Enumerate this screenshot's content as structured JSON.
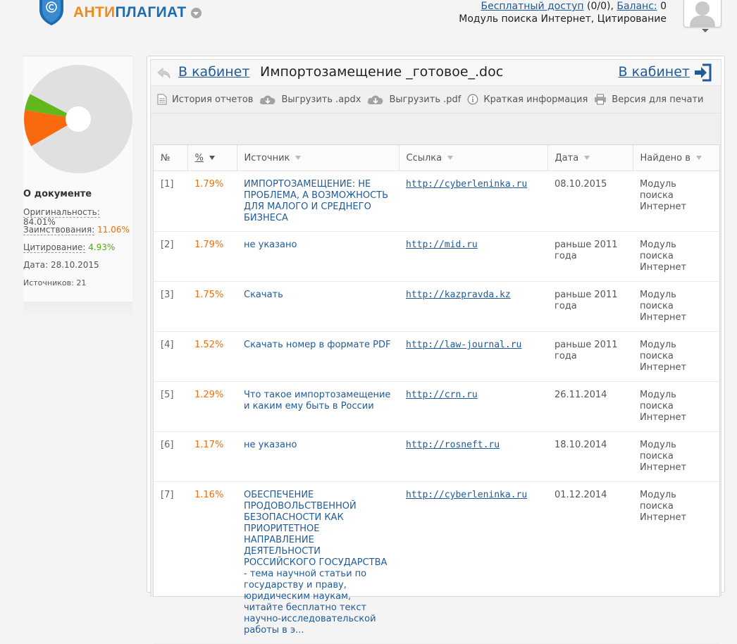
{
  "header": {
    "logo_part1": "АНТИ",
    "logo_part2": "ПЛАГИАТ",
    "free_access_label": "Бесплатный доступ",
    "free_access_value": "(0/0),",
    "balance_label": "Баланс:",
    "balance_value": "0",
    "modules": "Модуль поиска Интернет, Цитирование"
  },
  "sidebar": {
    "title": "О документе",
    "originality_label": "Оригинальность:",
    "originality_value": "84.01%",
    "borrowing_label": "Заимствования:",
    "borrowing_value": "11.06%",
    "citation_label": "Цитирование:",
    "citation_value": "4.93%",
    "date_label": "Дата:",
    "date_value": "28.10.2015",
    "sources_label": "Источников:",
    "sources_value": "21"
  },
  "chart_data": {
    "type": "pie",
    "slices": [
      {
        "label": "Оригинальность",
        "value": 84.01,
        "color": "#e0e0e0"
      },
      {
        "label": "Заимствования",
        "value": 11.06,
        "color": "#f96a0e"
      },
      {
        "label": "Цитирование",
        "value": 4.93,
        "color": "#62b71d"
      }
    ]
  },
  "panel": {
    "cabinet_link": "В кабинет",
    "doc_title": "Импортозамещение _готовое_.doc",
    "cabinet_link_right": "В кабинет"
  },
  "toolbar": {
    "history": "История отчетов",
    "export_apdx": "Выгрузить .apdx",
    "export_pdf": "Выгрузить .pdf",
    "brief": "Краткая информация",
    "print": "Версия для печати"
  },
  "table": {
    "headers": {
      "num": "№",
      "pct": "%",
      "source": "Источник",
      "link": "Ссылка",
      "date": "Дата",
      "found": "Найдено в"
    },
    "rows": [
      {
        "num": "[1]",
        "pct": "1.79%",
        "source": "ИМПОРТОЗАМЕЩЕНИЕ: НЕ ПРОБЛЕМА, А ВОЗМОЖНОСТЬ ДЛЯ МАЛОГО И СРЕДНЕГО БИЗНЕСА",
        "link": "http://cyberleninka.ru",
        "date": "08.10.2015",
        "found": "Модуль поиска Интернет"
      },
      {
        "num": "[2]",
        "pct": "1.79%",
        "source": "не указано",
        "link": "http://mid.ru",
        "date": "раньше 2011 года",
        "found": "Модуль поиска Интернет"
      },
      {
        "num": "[3]",
        "pct": "1.75%",
        "source": "Скачать",
        "link": "http://kazpravda.kz",
        "date": "раньше 2011 года",
        "found": "Модуль поиска Интернет"
      },
      {
        "num": "[4]",
        "pct": "1.52%",
        "source": "Скачать номер в формате PDF",
        "link": "http://law-journal.ru",
        "date": "раньше 2011 года",
        "found": "Модуль поиска Интернет"
      },
      {
        "num": "[5]",
        "pct": "1.29%",
        "source": "Что такое импортозамещение и каким ему быть в России",
        "link": "http://crn.ru",
        "date": "26.11.2014",
        "found": "Модуль поиска Интернет"
      },
      {
        "num": "[6]",
        "pct": "1.17%",
        "source": "не указано",
        "link": "http://rosneft.ru",
        "date": "18.10.2014",
        "found": "Модуль поиска Интернет"
      },
      {
        "num": "[7]",
        "pct": "1.16%",
        "source": "ОБЕСПЕЧЕНИЕ ПРОДОВОЛЬСТВЕННОЙ БЕЗОПАСНОСТИ КАК ПРИОРИТЕТНОЕ НАПРАВЛЕНИЕ ДЕЯТЕЛЬНОСТИ РОССИЙСКОГО ГОСУДАРСТВА - тема научной статьи по государству и праву, юридическим наукам, читайте бесплатно текст научно-исследовательской работы в э...",
        "link": "http://cyberleninka.ru",
        "date": "01.12.2014",
        "found": "Модуль поиска Интернет"
      }
    ]
  }
}
